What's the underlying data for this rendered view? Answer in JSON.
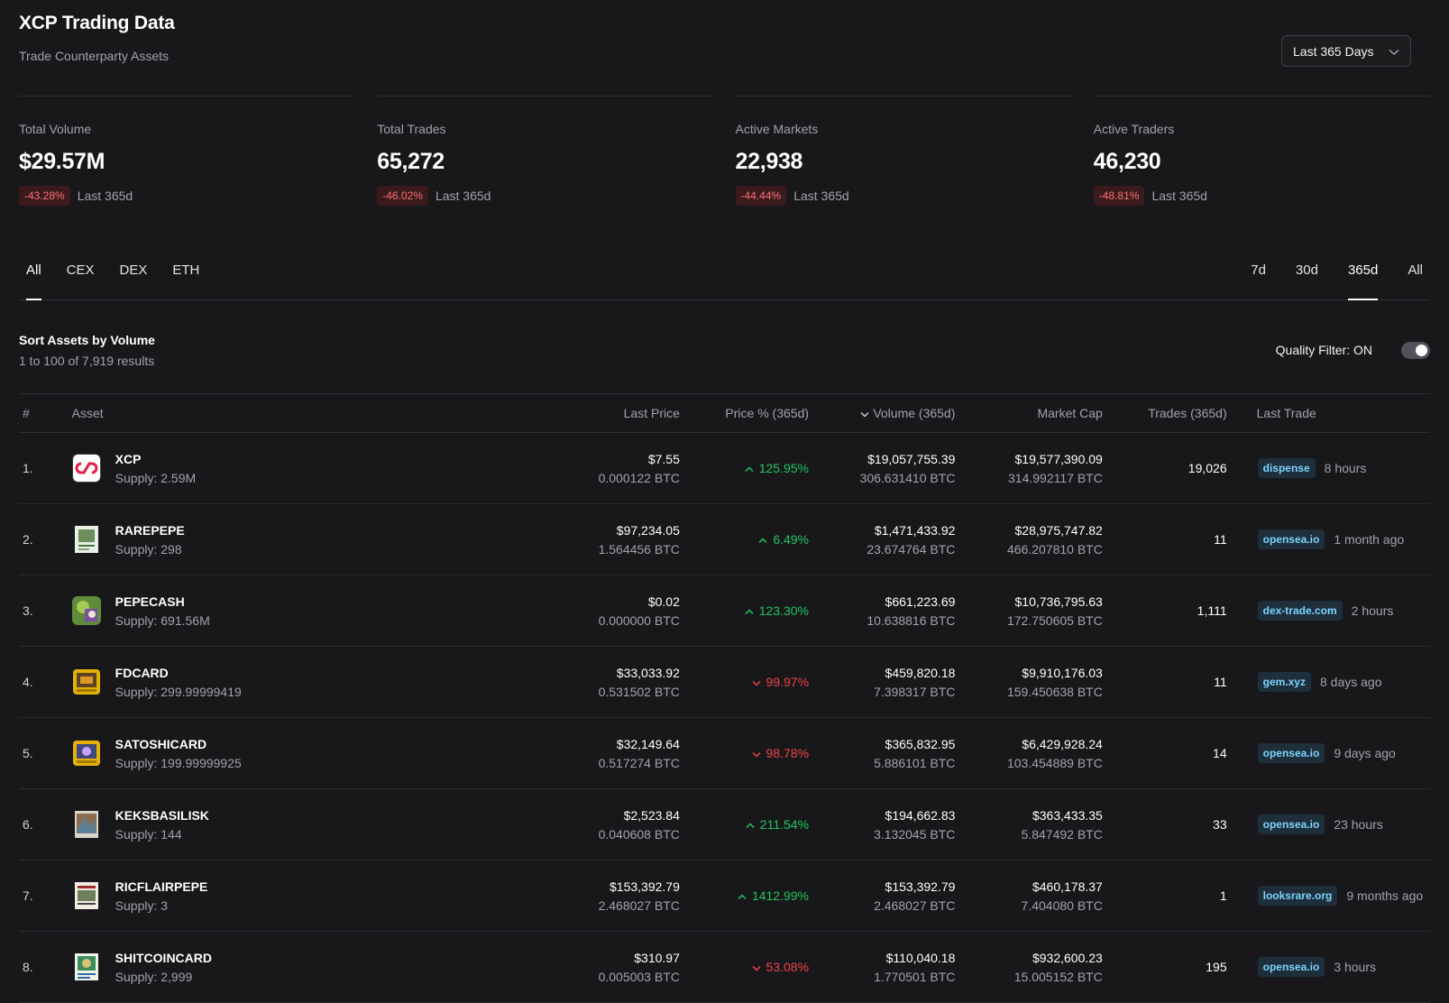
{
  "header": {
    "title": "XCP Trading Data",
    "subtitle": "Trade Counterparty Assets",
    "range_select": "Last 365 Days"
  },
  "stats": [
    {
      "label": "Total Volume",
      "value": "$29.57M",
      "change": "-43.28%",
      "period": "Last 365d"
    },
    {
      "label": "Total Trades",
      "value": "65,272",
      "change": "-46.02%",
      "period": "Last 365d"
    },
    {
      "label": "Active Markets",
      "value": "22,938",
      "change": "-44.44%",
      "period": "Last 365d"
    },
    {
      "label": "Active Traders",
      "value": "46,230",
      "change": "-48.81%",
      "period": "Last 365d"
    }
  ],
  "tabs": {
    "market": [
      "All",
      "CEX",
      "DEX",
      "ETH"
    ],
    "market_active": "All",
    "period": [
      "7d",
      "30d",
      "365d",
      "All"
    ],
    "period_active": "365d"
  },
  "controls": {
    "sort_title": "Sort Assets by Volume",
    "results": "1 to 100 of 7,919 results",
    "quality_filter": "Quality Filter: ON",
    "quality_on": true
  },
  "table": {
    "headers": [
      "#",
      "Asset",
      "Last Price",
      "Price % (365d)",
      "Volume (365d)",
      "Market Cap",
      "Trades (365d)",
      "Last Trade"
    ],
    "rows": [
      {
        "rank": "1.",
        "name": "XCP",
        "supply": "Supply: 2.59M",
        "price_usd": "$7.55",
        "price_btc": "0.000122 BTC",
        "change": "125.95%",
        "dir": "up",
        "volume_usd": "$19,057,755.39",
        "volume_btc": "306.631410 BTC",
        "mcap_usd": "$19,577,390.09",
        "mcap_btc": "314.992117 BTC",
        "trades": "19,026",
        "market": "dispense",
        "time": "8 hours",
        "icon": "xcp-logo-icon"
      },
      {
        "rank": "2.",
        "name": "RAREPEPE",
        "supply": "Supply: 298",
        "price_usd": "$97,234.05",
        "price_btc": "1.564456 BTC",
        "change": "6.49%",
        "dir": "up",
        "volume_usd": "$1,471,433.92",
        "volume_btc": "23.674764 BTC",
        "mcap_usd": "$28,975,747.82",
        "mcap_btc": "466.207810 BTC",
        "trades": "11",
        "market": "opensea.io",
        "time": "1 month ago",
        "icon": "rarepepe-card-icon"
      },
      {
        "rank": "3.",
        "name": "PEPECASH",
        "supply": "Supply: 691.56M",
        "price_usd": "$0.02",
        "price_btc": "0.000000 BTC",
        "change": "123.30%",
        "dir": "up",
        "volume_usd": "$661,223.69",
        "volume_btc": "10.638816 BTC",
        "mcap_usd": "$10,736,795.63",
        "mcap_btc": "172.750605 BTC",
        "trades": "1,111",
        "market": "dex-trade.com",
        "time": "2 hours",
        "icon": "pepecash-icon"
      },
      {
        "rank": "4.",
        "name": "FDCARD",
        "supply": "Supply: 299.99999419",
        "price_usd": "$33,033.92",
        "price_btc": "0.531502 BTC",
        "change": "99.97%",
        "dir": "down",
        "volume_usd": "$459,820.18",
        "volume_btc": "7.398317 BTC",
        "mcap_usd": "$9,910,176.03",
        "mcap_btc": "159.450638 BTC",
        "trades": "11",
        "market": "gem.xyz",
        "time": "8 days ago",
        "icon": "fdcard-icon"
      },
      {
        "rank": "5.",
        "name": "SATOSHICARD",
        "supply": "Supply: 199.99999925",
        "price_usd": "$32,149.64",
        "price_btc": "0.517274 BTC",
        "change": "98.78%",
        "dir": "down",
        "volume_usd": "$365,832.95",
        "volume_btc": "5.886101 BTC",
        "mcap_usd": "$6,429,928.24",
        "mcap_btc": "103.454889 BTC",
        "trades": "14",
        "market": "opensea.io",
        "time": "9 days ago",
        "icon": "satoshicard-icon"
      },
      {
        "rank": "6.",
        "name": "KEKSBASILISK",
        "supply": "Supply: 144",
        "price_usd": "$2,523.84",
        "price_btc": "0.040608 BTC",
        "change": "211.54%",
        "dir": "up",
        "volume_usd": "$194,662.83",
        "volume_btc": "3.132045 BTC",
        "mcap_usd": "$363,433.35",
        "mcap_btc": "5.847492 BTC",
        "trades": "33",
        "market": "opensea.io",
        "time": "23 hours",
        "icon": "keksbasilisk-icon"
      },
      {
        "rank": "7.",
        "name": "RICFLAIRPEPE",
        "supply": "Supply: 3",
        "price_usd": "$153,392.79",
        "price_btc": "2.468027 BTC",
        "change": "1412.99%",
        "dir": "up",
        "volume_usd": "$153,392.79",
        "volume_btc": "2.468027 BTC",
        "mcap_usd": "$460,178.37",
        "mcap_btc": "7.404080 BTC",
        "trades": "1",
        "market": "looksrare.org",
        "time": "9 months ago",
        "icon": "ricflairpepe-icon"
      },
      {
        "rank": "8.",
        "name": "SHITCOINCARD",
        "supply": "Supply: 2,999",
        "price_usd": "$310.97",
        "price_btc": "0.005003 BTC",
        "change": "53.08%",
        "dir": "down",
        "volume_usd": "$110,040.18",
        "volume_btc": "1.770501 BTC",
        "mcap_usd": "$932,600.23",
        "mcap_btc": "15.005152 BTC",
        "trades": "195",
        "market": "opensea.io",
        "time": "3 hours",
        "icon": "shitcoincard-icon"
      }
    ]
  },
  "colors": {
    "background": "#18181b",
    "positive": "#22c55e",
    "negative": "#ef4444",
    "badge_negative_bg": "#3b1a1e",
    "market_badge": "#7dd3fc",
    "xcp_brand": "#e11d48"
  }
}
